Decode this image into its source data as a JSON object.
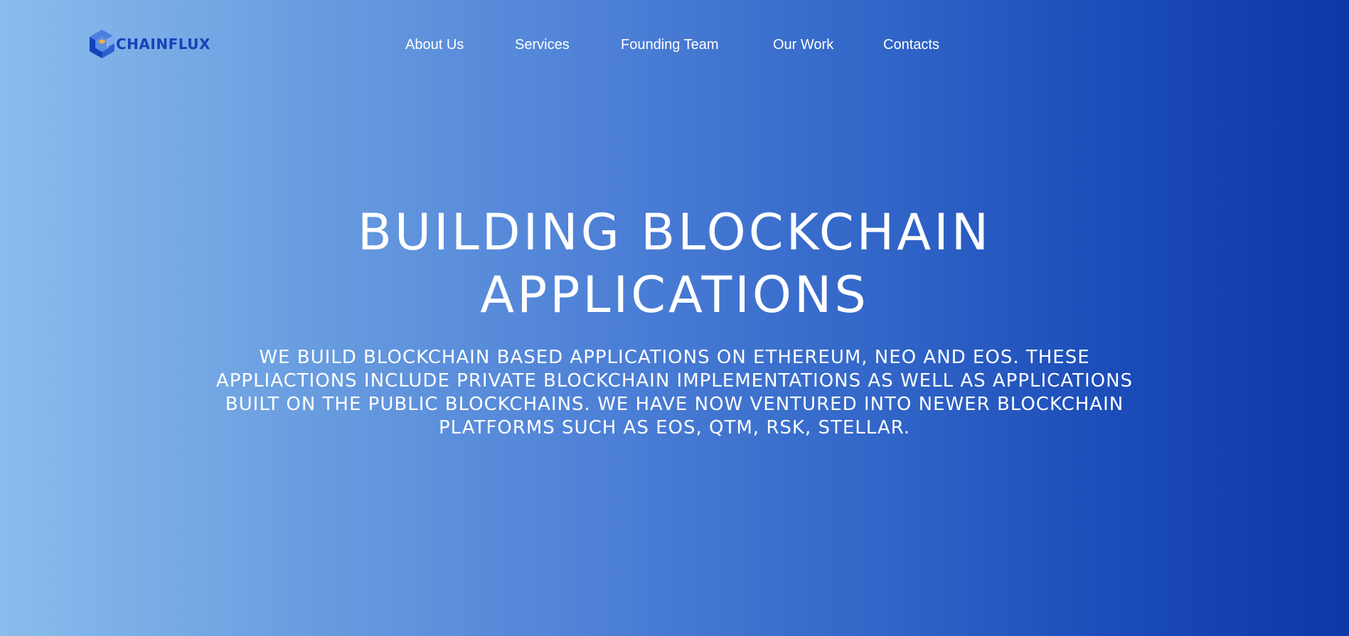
{
  "brand": {
    "name": "CHAINFLUX",
    "text_color": "#1442b8",
    "mark_colors": [
      "#2b5fd0",
      "#1442b8",
      "#4a7ee0",
      "#f0b53a"
    ]
  },
  "nav": {
    "items": [
      {
        "label": "About Us"
      },
      {
        "label": "Services"
      },
      {
        "label": "Founding Team"
      },
      {
        "label": "Our Work"
      },
      {
        "label": "Contacts"
      }
    ]
  },
  "hero": {
    "title_line1": "BUILDING BLOCKCHAIN",
    "title_line2": "APPLICATIONS",
    "subtitle_line1": "WE BUILD BLOCKCHAIN BASED APPLICATIONS ON ETHEREUM, NEO AND EOS. THESE",
    "subtitle_line2": "APPLIACTIONS INCLUDE PRIVATE BLOCKCHAIN IMPLEMENTATIONS AS WELL AS APPLICATIONS",
    "subtitle_line3": "BUILT ON THE PUBLIC BLOCKCHAINS. WE HAVE NOW VENTURED INTO NEWER BLOCKCHAIN",
    "subtitle_line4": "PLATFORMS SUCH AS EOS, QTM, RSK, STELLAR."
  },
  "colors": {
    "background_start": "#8abcec",
    "background_end": "#0c38a8",
    "text": "#ffffff"
  }
}
